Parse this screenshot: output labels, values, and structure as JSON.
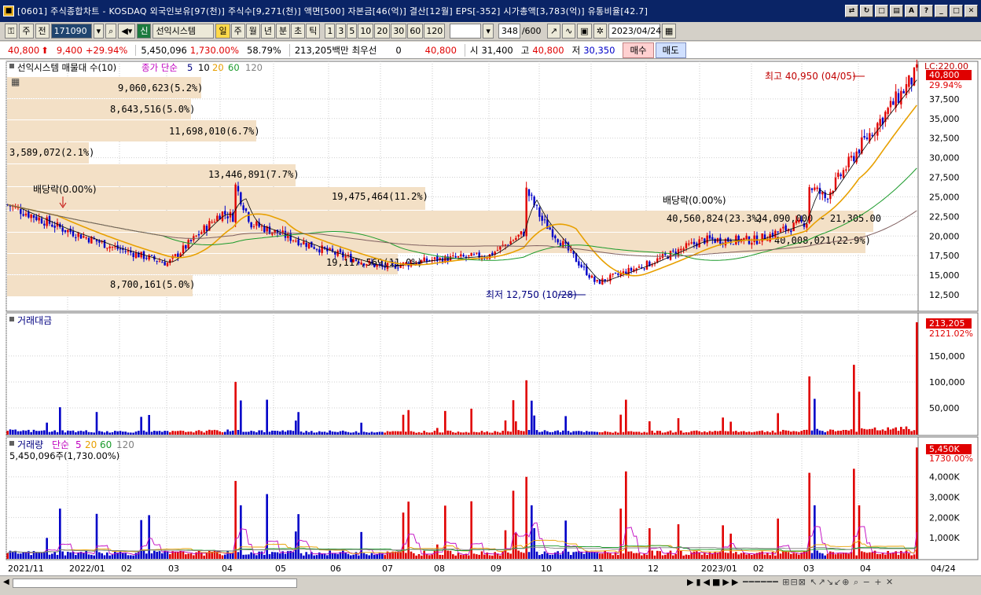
{
  "window": {
    "title": "[0601] 주식종합차트 - KOSDAQ 외국인보유[97(천)] 주식수[9,271(천)] 액면[500] 자본금[46(억)] 결산[12월] EPS[-352] 시가총액[3,783(억)] 유통비율[42.7]",
    "icon": "app-icon"
  },
  "toolbar": {
    "type_select": "주",
    "prev_label": "전",
    "code_value": "171090",
    "company_name": "선익시스템",
    "period_buttons": [
      "일",
      "주",
      "월",
      "년",
      "분",
      "초",
      "틱"
    ],
    "active_period": "일",
    "interval_buttons": [
      "1",
      "3",
      "5",
      "10",
      "20",
      "30",
      "60",
      "120"
    ],
    "count_value": "348",
    "count_total": "/600",
    "date_value": "2023/04/24"
  },
  "quote": {
    "price": "40,800",
    "change": "9,400",
    "change_pct": "+29.94%",
    "volume": "5,450,096",
    "volume_pct": "1,730.00%",
    "turnover": "58.79%",
    "amount": "213,205백만",
    "priority_label": "최우선",
    "priority_value": "0",
    "ask": "40,800",
    "open_label": "시",
    "open": "31,400",
    "high_label": "고",
    "high": "40,800",
    "low_label": "저",
    "low": "30,350",
    "buy_label": "매수",
    "sell_label": "매도"
  },
  "colors": {
    "up": "#e00000",
    "down": "#0000c8",
    "ma5": "#000000",
    "ma20": "#e8a000",
    "ma60": "#1a9a2a",
    "ma120": "#806060",
    "band": "#f3e0c6"
  },
  "main_panel": {
    "legend": [
      "선익시스템 매물대 수(10)",
      "종가 단순",
      "5",
      "10",
      "20",
      "60",
      "120"
    ],
    "yaxis_top": "LC:220.00",
    "price_tag": "40,800",
    "pct_tag": "29.94%",
    "high_note": "최고 40,950 (04/05)",
    "low_note": "최저 12,750 (10/28)",
    "dividend_notes": [
      "배당락(0.00%)",
      "배당락(0.00%)"
    ],
    "volume_profile_labels": [
      "9,060,623(5.2%)",
      "8,643,516(5.0%)",
      "11,698,010(6.7%)",
      "3,589,072(2.1%)",
      "13,446,891(7.7%)",
      "19,475,464(11.2%)",
      "40,560,824(23.3%)",
      "40,008,021(22.9%)",
      "19,117,569(11.0%)",
      "8,700,161(5.0%)"
    ],
    "range_note": "24,090,000 ~ 21,305.00",
    "yticks": [
      "37,500",
      "35,000",
      "32,500",
      "30,000",
      "27,500",
      "25,000",
      "22,500",
      "20,000",
      "17,500",
      "15,000",
      "12,500"
    ]
  },
  "amount_panel": {
    "legend": "거래대금",
    "value_tag": "213,205",
    "pct_tag": "2121.02%",
    "yticks": [
      "150,000",
      "100,000",
      "50,000"
    ]
  },
  "volume_panel": {
    "legend": [
      "거래량",
      "단순",
      "5",
      "20",
      "60",
      "120"
    ],
    "sub_legend": "5,450,096주(1,730.00%)",
    "value_tag": "5,450K",
    "pct_tag": "1730.00%",
    "yticks": [
      "4,000K",
      "3,000K",
      "2,000K",
      "1,000K"
    ]
  },
  "xaxis": [
    "2021/11",
    "2022/01",
    "02",
    "03",
    "04",
    "05",
    "06",
    "07",
    "08",
    "09",
    "10",
    "11",
    "12",
    "2023/01",
    "02",
    "03",
    "04",
    "04/24"
  ],
  "chart_data": {
    "type": "candlestick",
    "x_start": "2021-11",
    "x_end": "2023-04-24",
    "monthly_close": [
      {
        "m": "2021/11",
        "c": 24000
      },
      {
        "m": "2021/12",
        "c": 21000
      },
      {
        "m": "2022/01",
        "c": 18500
      },
      {
        "m": "2022/02",
        "c": 16500
      },
      {
        "m": "2022/03",
        "c": 23000
      },
      {
        "m": "2022/04",
        "c": 20500
      },
      {
        "m": "2022/05",
        "c": 18000
      },
      {
        "m": "2022/06",
        "c": 16000
      },
      {
        "m": "2022/07",
        "c": 17000
      },
      {
        "m": "2022/08",
        "c": 17500
      },
      {
        "m": "2022/09",
        "c": 22000
      },
      {
        "m": "2022/10",
        "c": 14000
      },
      {
        "m": "2022/11",
        "c": 16500
      },
      {
        "m": "2022/12",
        "c": 19500
      },
      {
        "m": "2023/01",
        "c": 19500
      },
      {
        "m": "2023/02",
        "c": 22000
      },
      {
        "m": "2023/03",
        "c": 32000
      },
      {
        "m": "2023/04",
        "c": 40800
      }
    ],
    "ylim": [
      11000,
      41500
    ],
    "high": 40950,
    "low": 12750,
    "last_close": 40800,
    "last_volume": 5450096,
    "last_amount": 213205
  }
}
